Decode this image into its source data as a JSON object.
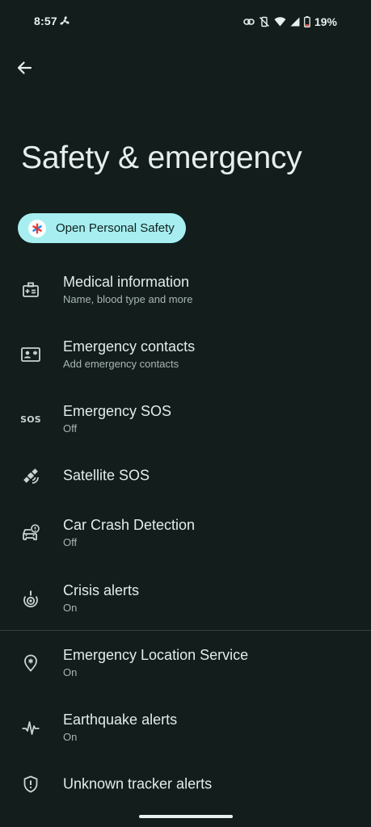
{
  "status_bar": {
    "time": "8:57",
    "battery": "19%"
  },
  "page": {
    "title": "Safety & emergency",
    "open_button_label": "Open Personal Safety"
  },
  "items": [
    {
      "title": "Medical information",
      "subtitle": "Name, blood type and more",
      "icon": "medical-id-icon"
    },
    {
      "title": "Emergency contacts",
      "subtitle": "Add emergency contacts",
      "icon": "contact-card-icon"
    },
    {
      "title": "Emergency SOS",
      "subtitle": "Off",
      "icon": "sos-icon",
      "icon_text": "SOS"
    },
    {
      "title": "Satellite SOS",
      "subtitle": "",
      "icon": "satellite-icon"
    },
    {
      "title": "Car Crash Detection",
      "subtitle": "Off",
      "icon": "car-crash-icon"
    },
    {
      "title": "Crisis alerts",
      "subtitle": "On",
      "icon": "crisis-alert-icon"
    },
    {
      "title": "Emergency Location Service",
      "subtitle": "On",
      "icon": "location-pin-icon"
    },
    {
      "title": "Earthquake alerts",
      "subtitle": "On",
      "icon": "earthquake-icon"
    },
    {
      "title": "Unknown tracker alerts",
      "subtitle": "",
      "icon": "shield-alert-icon"
    }
  ],
  "colors": {
    "background": "#121d1c",
    "accent_button": "#a7eef0",
    "text_primary": "#e4ecea",
    "text_secondary": "#a9b6b3"
  }
}
